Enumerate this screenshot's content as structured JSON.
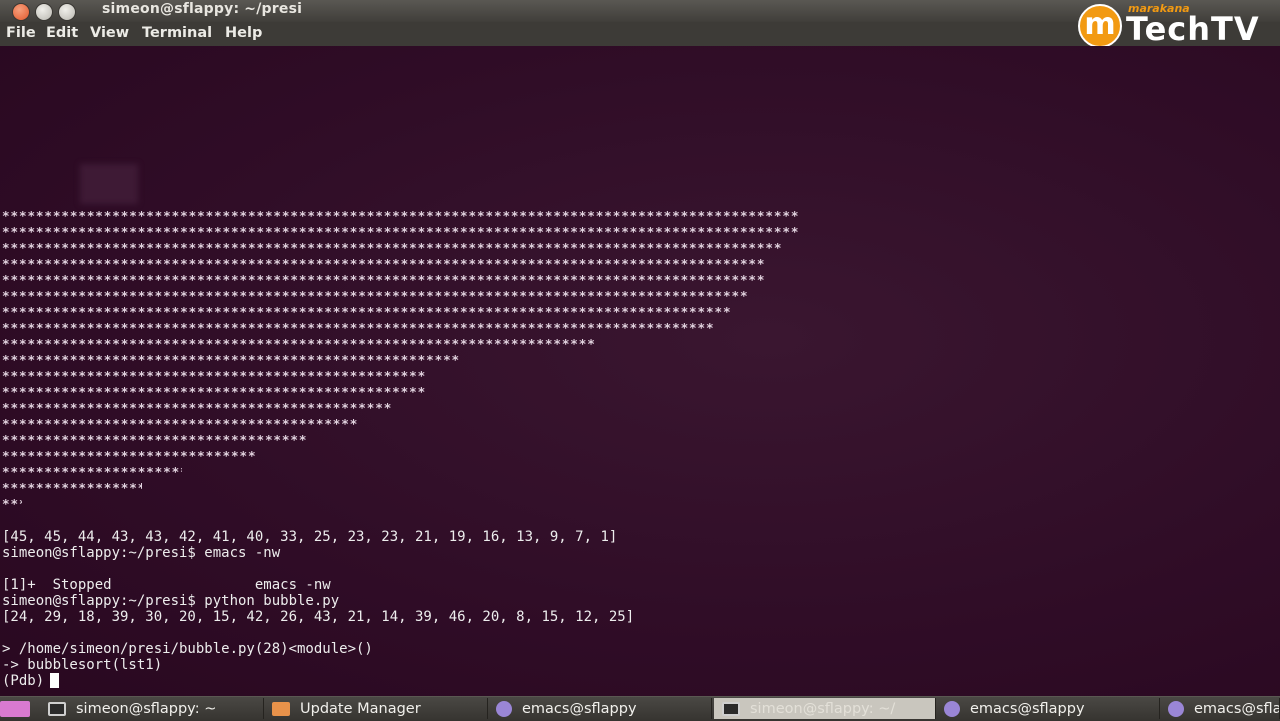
{
  "window": {
    "title": "simeon@sflappy: ~/presi",
    "menu": [
      "File",
      "Edit",
      "View",
      "Terminal",
      "Help"
    ]
  },
  "watermark": {
    "brand": "marakana",
    "product": "TechTV",
    "icon": "m-circle-logo"
  },
  "terminal": {
    "star_rows": [
      45,
      45,
      44,
      43,
      43,
      42,
      41,
      40,
      33,
      25,
      23,
      23,
      21,
      19,
      16,
      13,
      9,
      7,
      1
    ],
    "lines": [
      "[45, 45, 44, 43, 43, 42, 41, 40, 33, 25, 23, 23, 21, 19, 16, 13, 9, 7, 1]",
      "simeon@sflappy:~/presi$ emacs -nw",
      "",
      "[1]+  Stopped                 emacs -nw",
      "simeon@sflappy:~/presi$ python bubble.py",
      "[24, 29, 18, 39, 30, 20, 15, 42, 26, 43, 21, 14, 39, 46, 20, 8, 15, 12, 25]",
      "",
      "> /home/simeon/presi/bubble.py(28)<module>()",
      "-> bubblesort(lst1)"
    ],
    "prompt": "(Pdb)"
  },
  "taskbar": {
    "items": [
      {
        "label": "simeon@sflappy: ~",
        "icon": "terminal-icon"
      },
      {
        "label": "Update Manager",
        "icon": "folder-icon"
      },
      {
        "label": "emacs@sflappy",
        "icon": "emacs-icon"
      },
      {
        "label": "simeon@sflappy: ~/",
        "icon": "terminal-icon"
      },
      {
        "label": "emacs@sflappy",
        "icon": "emacs-icon"
      },
      {
        "label": "emacs@sflappy",
        "icon": "emacs-icon"
      }
    ]
  },
  "colors": {
    "terminal_bg": "#300d27",
    "text": "#ededed",
    "logo_orange": "#f29a12"
  }
}
